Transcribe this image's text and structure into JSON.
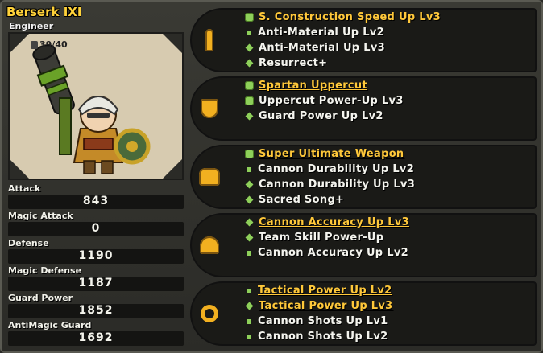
{
  "character": {
    "name": "Berserk IXI",
    "class": "Engineer",
    "level": "39/40"
  },
  "stats": [
    {
      "label": "Attack",
      "value": "843"
    },
    {
      "label": "Magic Attack",
      "value": "0"
    },
    {
      "label": "Defense",
      "value": "1190"
    },
    {
      "label": "Magic Defense",
      "value": "1187"
    },
    {
      "label": "Guard Power",
      "value": "1852"
    },
    {
      "label": "AntiMagic Guard",
      "value": "1692"
    }
  ],
  "equipment": [
    {
      "slot_icon": "weapon-icon",
      "skills": [
        {
          "name": "S. Construction Speed Up Lv3",
          "style": "gold",
          "marker": "hex"
        },
        {
          "name": "Anti-Material Up Lv2",
          "style": "white",
          "marker": "square"
        },
        {
          "name": "Anti-Material Up Lv3",
          "style": "white",
          "marker": "diamond"
        },
        {
          "name": "Resurrect+",
          "style": "white",
          "marker": "diamond"
        }
      ]
    },
    {
      "slot_icon": "shield-icon",
      "skills": [
        {
          "name": "Spartan Uppercut",
          "style": "gold",
          "marker": "hex"
        },
        {
          "name": "Uppercut Power-Up Lv3",
          "style": "white",
          "marker": "hex"
        },
        {
          "name": "Guard Power Up Lv2",
          "style": "white",
          "marker": "diamond"
        }
      ]
    },
    {
      "slot_icon": "armor-icon",
      "skills": [
        {
          "name": "Super Ultimate Weapon",
          "style": "gold",
          "marker": "hex"
        },
        {
          "name": "Cannon Durability Up Lv2",
          "style": "white",
          "marker": "square"
        },
        {
          "name": "Cannon Durability Up Lv3",
          "style": "white",
          "marker": "diamond"
        },
        {
          "name": "Sacred Song+",
          "style": "white",
          "marker": "diamond"
        }
      ]
    },
    {
      "slot_icon": "helmet-icon",
      "skills": [
        {
          "name": "Cannon Accuracy Up Lv3",
          "style": "gold",
          "marker": "diamond"
        },
        {
          "name": "Team Skill Power-Up",
          "style": "white",
          "marker": "diamond"
        },
        {
          "name": "Cannon Accuracy Up Lv2",
          "style": "white",
          "marker": "square"
        }
      ]
    },
    {
      "slot_icon": "ring-icon",
      "skills": [
        {
          "name": "Tactical Power Up Lv2",
          "style": "gold",
          "marker": "square"
        },
        {
          "name": "Tactical Power Up Lv3",
          "style": "gold",
          "marker": "diamond"
        },
        {
          "name": "Cannon Shots Up Lv1",
          "style": "white",
          "marker": "square"
        },
        {
          "name": "Cannon Shots Up Lv2",
          "style": "white",
          "marker": "square"
        }
      ]
    }
  ],
  "colors": {
    "gold_text": "#ffc83a",
    "name_text": "#ffd23a",
    "marker_green": "#8ed05a",
    "icon_gold": "#f2b020"
  }
}
